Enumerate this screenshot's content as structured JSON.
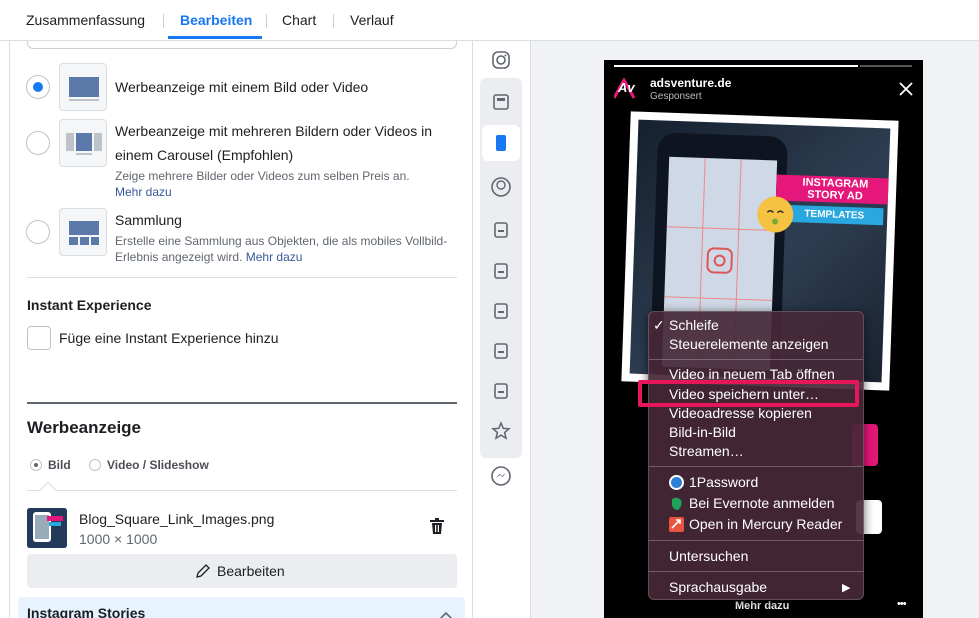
{
  "tabs": {
    "summary": "Zusammenfassung",
    "edit": "Bearbeiten",
    "chart": "Chart",
    "history": "Verlauf"
  },
  "format": {
    "single": {
      "title": "Werbeanzeige mit einem Bild oder Video"
    },
    "carousel": {
      "title_line1": "Werbeanzeige mit mehreren Bildern oder Videos in",
      "title_line2": "einem Carousel (Empfohlen)",
      "desc": "Zeige mehrere Bilder oder Videos zum selben Preis an.",
      "link": "Mehr dazu"
    },
    "collection": {
      "title": "Sammlung",
      "desc_line1": "Erstelle eine Sammlung aus Objekten, die als mobiles Vollbild-",
      "desc_line2": "Erlebnis angezeigt wird.",
      "link": "Mehr dazu"
    }
  },
  "instant": {
    "heading": "Instant Experience",
    "checkbox_label": "Füge eine Instant Experience hinzu"
  },
  "ad": {
    "heading": "Werbeanzeige",
    "opt_image": "Bild",
    "opt_video": "Video / Slideshow",
    "file_name": "Blog_Square_Link_Images.png",
    "file_dims": "1000 × 1000",
    "edit_button": "Bearbeiten",
    "placement": "Instagram Stories"
  },
  "preview": {
    "account": "adsventure.de",
    "sponsored": "Gesponsert",
    "logo_text": "Av",
    "banner_line1": "INSTAGRAM",
    "banner_line2": "STORY AD",
    "banner_templates": "TEMPLATES",
    "cta": "Mehr dazu",
    "more": "•••"
  },
  "context_menu": {
    "loop_check": "✓",
    "loop": "Schleife",
    "show_controls": "Steuerelemente anzeigen",
    "open_tab": "Video in neuem Tab öffnen",
    "save_as": "Video speichern unter…",
    "copy_address": "Videoadresse kopieren",
    "pip": "Bild-in-Bild",
    "stream": "Streamen…",
    "onepassword": "1Password",
    "evernote": "Bei Evernote anmelden",
    "mercury": "Open in Mercury Reader",
    "inspect": "Untersuchen",
    "speech": "Sprachausgabe",
    "submenu_arrow": "▶"
  },
  "colors": {
    "accent": "#1877f2",
    "highlight": "#e5175a",
    "banner_pink": "#e5177a",
    "banner_blue": "#29a8e0"
  }
}
